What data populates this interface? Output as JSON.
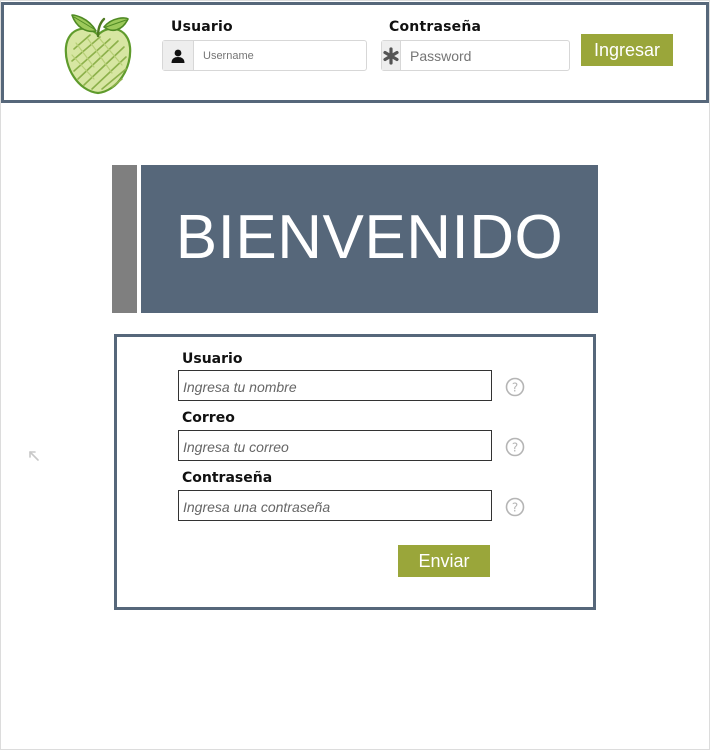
{
  "header": {
    "username_label": "Usuario",
    "username_placeholder": "Username",
    "username_icon": "user-icon",
    "password_label": "Contraseña",
    "password_placeholder": "Password",
    "password_icon": "asterisk-icon",
    "login_button": "Ingresar"
  },
  "banner": {
    "title": "BIENVENIDO"
  },
  "form": {
    "fields": [
      {
        "label": "Usuario",
        "placeholder": "Ingresa tu nombre"
      },
      {
        "label": "Correo",
        "placeholder": "Ingresa tu correo"
      },
      {
        "label": "Contraseña",
        "placeholder": "Ingresa una contraseña"
      }
    ],
    "help_icon": "question-circle-icon",
    "submit_button": "Enviar"
  },
  "colors": {
    "accent_green": "#9aa63a",
    "slate": "#56677a",
    "banner_side_gray": "#7f7f7f"
  }
}
